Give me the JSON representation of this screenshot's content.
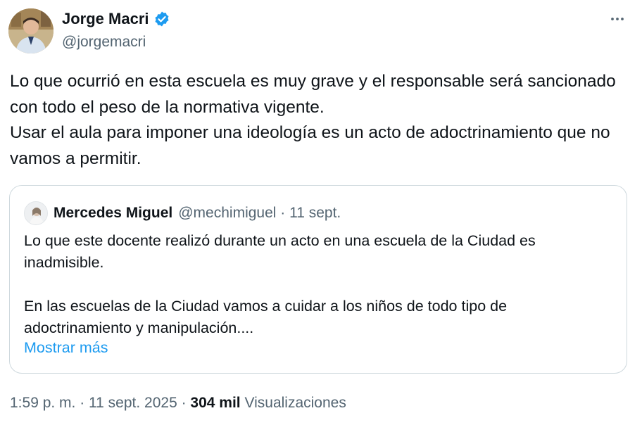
{
  "author": {
    "name": "Jorge Macri",
    "handle": "@jorgemacri",
    "verified": true,
    "verified_color": "#1d9bf0"
  },
  "tweet": {
    "lines": [
      "Lo que ocurrió en esta escuela es muy grave y el responsable será sancionado con todo el peso de la normativa vigente.",
      "Usar el aula para imponer una ideología es un acto de adoctrinamiento que no vamos a permitir."
    ]
  },
  "quote": {
    "name": "Mercedes Miguel",
    "handle_and_date": "@mechimiguel · 11 sept.",
    "paragraphs": [
      "Lo que este docente realizó durante un acto en una escuela de la Ciudad es inadmisible.",
      "En las escuelas de la Ciudad vamos a cuidar a los niños de todo tipo de adoctrinamiento y manipulación...."
    ],
    "show_more_label": "Mostrar más"
  },
  "meta": {
    "timestamp": "1:59 p. m. · 11 sept. 2025 · ",
    "views_count": "304 mil",
    "views_label": " Visualizaciones"
  },
  "icons": {
    "more": "more-horizontal-icon",
    "verified": "verified-badge-icon"
  },
  "colors": {
    "text": "#0f1419",
    "secondary": "#536471",
    "link": "#1d9bf0",
    "border": "#cfd9de"
  }
}
